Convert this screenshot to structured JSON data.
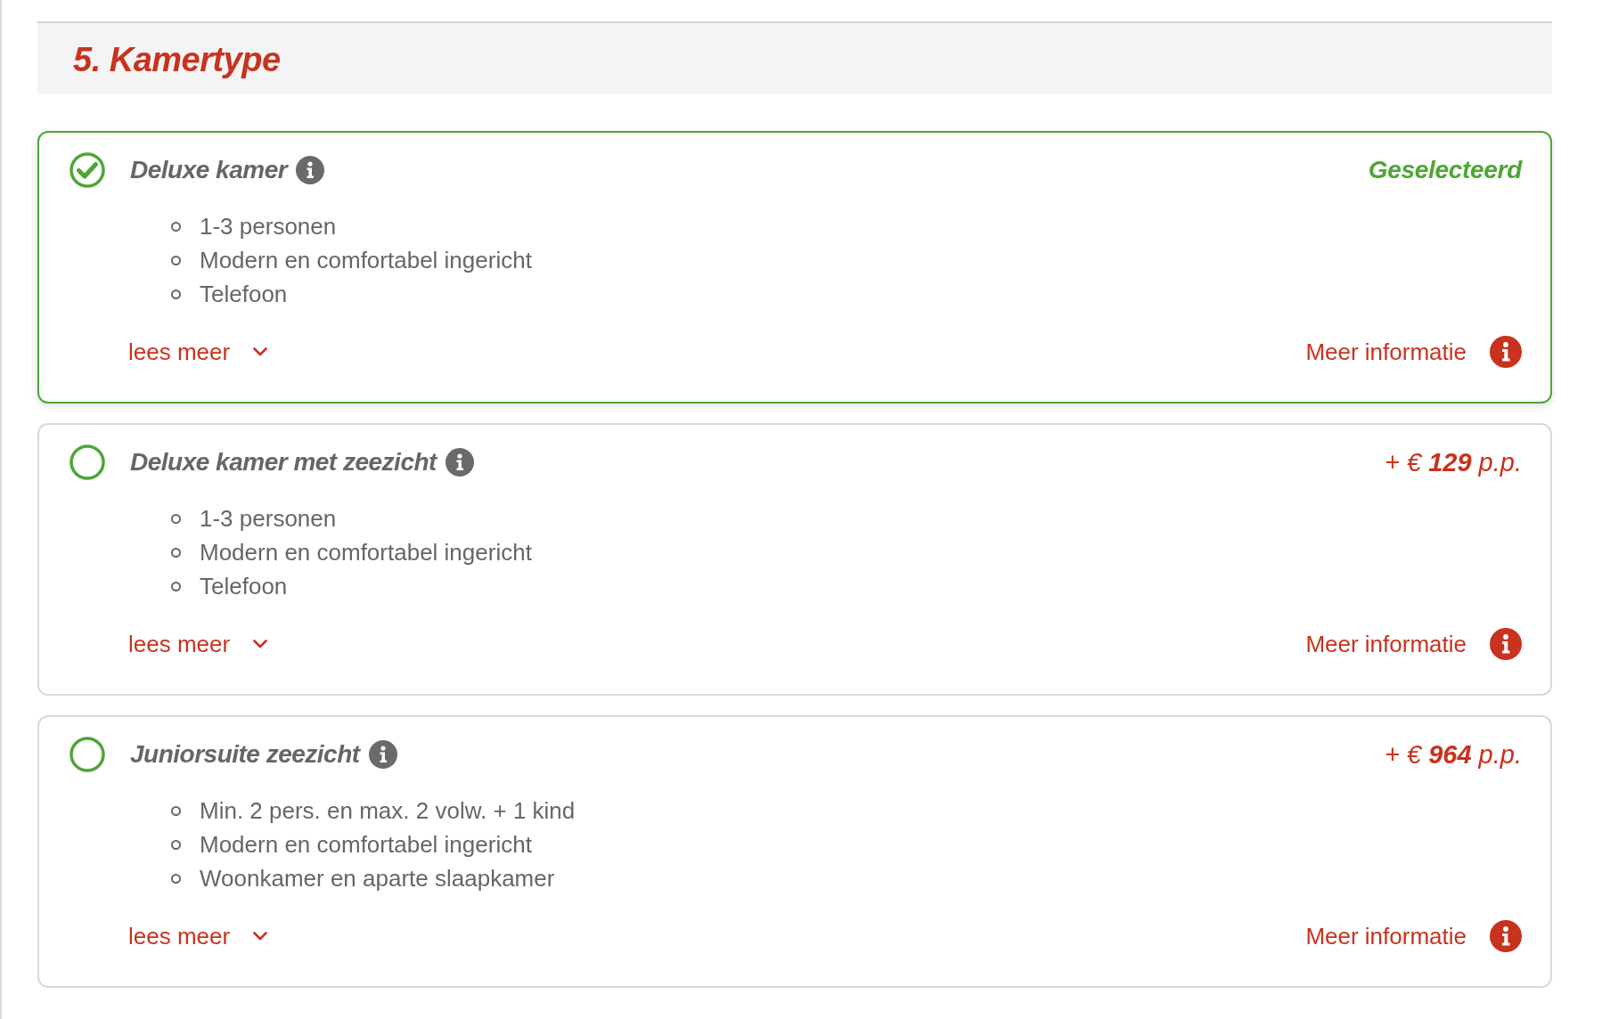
{
  "section": {
    "title": "5. Kamertype"
  },
  "rooms": [
    {
      "name": "Deluxe kamer",
      "selected": true,
      "price_label": "Geselecteerd",
      "features": [
        "1-3 personen",
        "Modern en comfortabel ingericht",
        "Telefoon"
      ],
      "read_more": "lees meer",
      "more_info": "Meer informatie"
    },
    {
      "name": "Deluxe kamer met zeezicht",
      "selected": false,
      "price_label": "+ € **129** p.p.",
      "features": [
        "1-3 personen",
        "Modern en comfortabel ingericht",
        "Telefoon"
      ],
      "read_more": "lees meer",
      "more_info": "Meer informatie"
    },
    {
      "name": "Juniorsuite zeezicht",
      "selected": false,
      "price_label": "+ € **964** p.p.",
      "features": [
        "Min. 2 pers. en max. 2 volw. + 1 kind",
        "Modern en comfortabel ingericht",
        "Woonkamer en aparte slaapkamer"
      ],
      "read_more": "lees meer",
      "more_info": "Meer informatie"
    }
  ]
}
